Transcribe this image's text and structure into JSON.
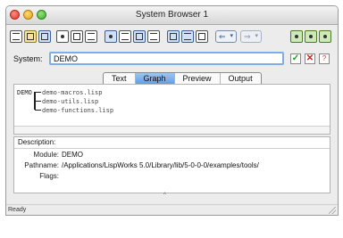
{
  "window": {
    "title": "System Browser 1"
  },
  "system": {
    "label": "System:",
    "value": "DEMO"
  },
  "tabs": [
    "Text",
    "Graph",
    "Preview",
    "Output"
  ],
  "graph": {
    "root": "DEMO",
    "children": [
      "demo-macros.lisp",
      "demo-utils.lisp",
      "demo-functions.lisp"
    ]
  },
  "description": {
    "header": "Description:",
    "rows": [
      {
        "label": "Module:",
        "value": "DEMO"
      },
      {
        "label": "Pathname:",
        "value": "/Applications/LispWorks 5.0/Library/lib/5-0-0-0/examples/tools/"
      },
      {
        "label": "Flags:",
        "value": ""
      }
    ]
  },
  "status": {
    "text": "Ready"
  },
  "splitter_glyph": "^",
  "actions": {
    "ok": "✓",
    "cancel": "✕",
    "help": "?"
  },
  "nav": {
    "back": "⇐",
    "forward": "⇒",
    "menu": "▾"
  },
  "icons": {
    "toolbar_left": [
      "new-icon",
      "open-icon",
      "save-icon",
      "cut-icon",
      "copy-icon",
      "paste-icon",
      "compile-icon",
      "load-icon",
      "edit-icon",
      "browse-icon",
      "inspect-icon",
      "list-icon",
      "graph-icon"
    ],
    "toolbar_right": [
      "link-icon",
      "link-plus-icon",
      "link-edit-icon"
    ]
  }
}
